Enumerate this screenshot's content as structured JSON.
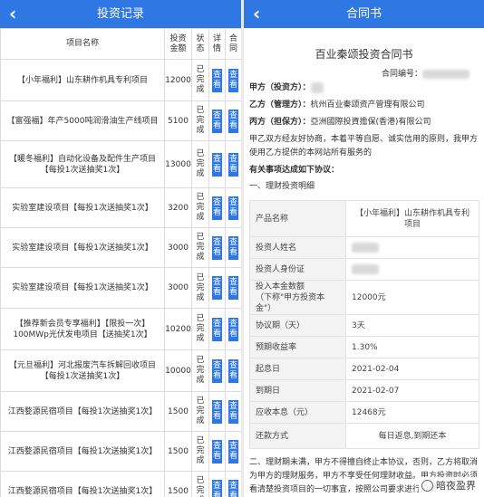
{
  "left": {
    "title": "投资记录",
    "headers": {
      "name": "项目名称",
      "amount": [
        "投资",
        "金额"
      ],
      "status": [
        "状",
        "态"
      ],
      "detail": [
        "详",
        "情"
      ],
      "contract": [
        "合",
        "同"
      ]
    },
    "view_label": [
      "查",
      "看"
    ],
    "rows": [
      {
        "name": "【小年福利】山东耕作机具专利项目",
        "amount": "12000",
        "status": [
          "已",
          "完",
          "成"
        ]
      },
      {
        "name": "【富强福】年产5000吨润滑油生产线项目",
        "amount": "5100",
        "status": [
          "已",
          "完",
          "成"
        ]
      },
      {
        "name": "【暖冬福利】自动化设备及配件生产项目【每投1次送抽奖1次】",
        "amount": "13000",
        "status": [
          "已",
          "完",
          "成"
        ]
      },
      {
        "name": "实验室建设项目【每投1次送抽奖1次】",
        "amount": "3200",
        "status": [
          "已",
          "完",
          "成"
        ]
      },
      {
        "name": "实验室建设项目【每投1次送抽奖1次】",
        "amount": "3000",
        "status": [
          "已",
          "完",
          "成"
        ]
      },
      {
        "name": "实验室建设项目【每投1次送抽奖1次】",
        "amount": "3000",
        "status": [
          "已",
          "完",
          "成"
        ]
      },
      {
        "name": "【推荐新会员专享福利】【限投一次】100MWp光伏发电项目【送抽奖1次】",
        "amount": "10200",
        "status": [
          "已",
          "完",
          "成"
        ]
      },
      {
        "name": "【元旦福利】河北报废汽车拆解回收项目【每投1次送抽奖1次】",
        "amount": "10000",
        "status": [
          "已",
          "完",
          "成"
        ]
      },
      {
        "name": "江西婺源民宿项目【每投1次送抽奖1次】",
        "amount": "1500",
        "status": [
          "已",
          "完",
          "成"
        ]
      },
      {
        "name": "江西婺源民宿项目【每投1次送抽奖1次】",
        "amount": "1500",
        "status": [
          "已",
          "完",
          "成"
        ]
      },
      {
        "name": "江西婺源民宿项目【每投1次送抽奖1次】",
        "amount": "1500",
        "status": [
          "已",
          "完",
          "成"
        ]
      }
    ]
  },
  "right": {
    "title": "合同书",
    "doc_title": "百业秦颂投资合同书",
    "contract_no_label": "合同编号：",
    "party_a_label": "甲方（投资方）：",
    "party_b_label": "乙方（管理方）：",
    "party_b": "杭州百业秦颂资产管理有限公司",
    "party_c_label": "丙方（担保方）：",
    "party_c": "亞洲國際投資擔保(香港)有限公司",
    "intro": "甲乙双方经友好协商，本着平等自愿、诚实信用的原则，我甲方使用乙方提供的本网站所有服务的",
    "heading": "有关事项达成如下协议：",
    "section1": "一、理财投资明细",
    "details": [
      {
        "k": "产品名称",
        "v": "【小年福利】山东耕作机具专利项目",
        "center": true
      },
      {
        "k": "投资人姓名",
        "v": "",
        "blur": true
      },
      {
        "k": "投资人身份证",
        "v": "",
        "blur": true
      },
      {
        "k": "投入本金数额\n（下称\"甲方投资本金\"）",
        "v": "12000元"
      },
      {
        "k": "协议期（天）",
        "v": "3天"
      },
      {
        "k": "预期收益率",
        "v": "1.30%"
      },
      {
        "k": "起息日",
        "v": "2021-02-04"
      },
      {
        "k": "到期日",
        "v": "2021-02-07"
      },
      {
        "k": "应收本息（元）",
        "v": "12468元"
      },
      {
        "k": "还款方式",
        "v": "每日返息,到期还本",
        "center": true
      }
    ],
    "section2": "二、理财期未满，甲方不得擅自终止本协议，否则，乙方将取消为甲方的理财服务，甲方不享受任何理财收益。甲方投资时必须看清楚投资项目的一切事宜，按照公司要求进行投资"
  },
  "watermark": "暗夜盈界"
}
